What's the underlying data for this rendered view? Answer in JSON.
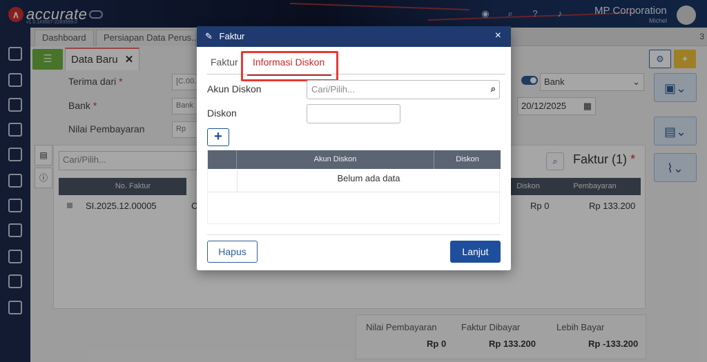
{
  "app": {
    "logo_text": "accurate",
    "version": "v1.0.1#3507-2283599.0",
    "company": "MP Corporation",
    "user": "Michel"
  },
  "tabs": {
    "items": [
      {
        "label": "Dashboard"
      },
      {
        "label": "Persiapan Data Perus..."
      }
    ],
    "count": "3"
  },
  "form": {
    "tab_title": "Data Baru",
    "terima_dari_label": "Terima dari",
    "terima_dari_value": "[C.00...",
    "bank_label": "Bank",
    "bank_value": "Bank",
    "nilai_label": "Nilai Pembayaran",
    "nilai_prefix": "Rp",
    "bank_select": "Bank",
    "date": "20/12/2025",
    "search_placeholder": "Cari/Pilih...",
    "faktur_title": "Faktur (1)",
    "grid_headers": [
      "No. Faktur",
      "Diskon",
      "Pembayaran"
    ],
    "row": {
      "no_faktur": "SI.2025.12.00005",
      "diskon": "Rp 0",
      "pembayaran": "Rp 133.200",
      "trunc": "C"
    }
  },
  "summary": {
    "nilai_label": "Nilai Pembayaran",
    "nilai_value": "Rp 0",
    "faktur_label": "Faktur Dibayar",
    "faktur_value": "Rp 133.200",
    "lebih_label": "Lebih Bayar",
    "lebih_value": "Rp -133.200"
  },
  "modal": {
    "title": "Faktur",
    "close": "×",
    "tab_faktur": "Faktur",
    "tab_info": "Informasi Diskon",
    "akun_label": "Akun Diskon",
    "akun_placeholder": "Cari/Pilih...",
    "diskon_label": "Diskon",
    "add": "+",
    "col_akun": "Akun Diskon",
    "col_diskon": "Diskon",
    "empty": "Belum ada data",
    "hapus": "Hapus",
    "lanjut": "Lanjut"
  }
}
